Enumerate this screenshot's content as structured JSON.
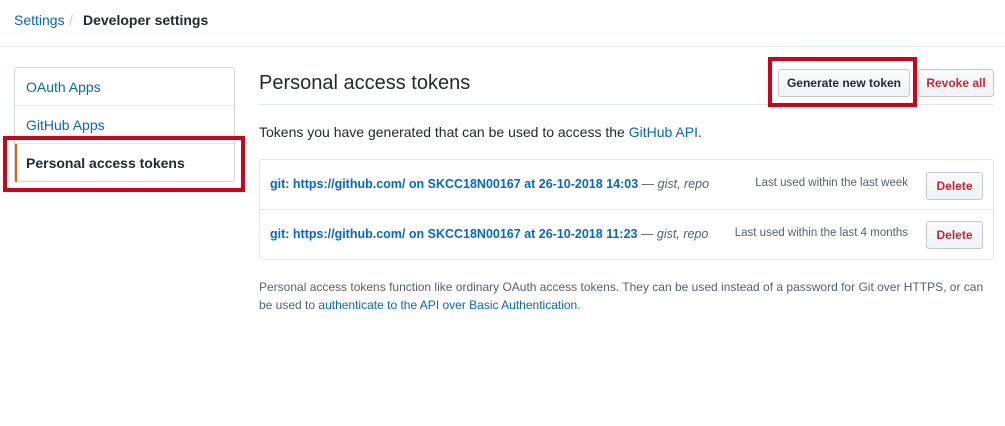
{
  "breadcrumb": {
    "parent": "Settings",
    "separator": "/",
    "current": "Developer settings"
  },
  "sidebar": {
    "items": [
      {
        "label": "OAuth Apps"
      },
      {
        "label": "GitHub Apps"
      },
      {
        "label": "Personal access tokens",
        "selected": true
      }
    ]
  },
  "main": {
    "title": "Personal access tokens",
    "generate_button": "Generate new token",
    "revoke_button": "Revoke all",
    "intro_text": "Tokens you have generated that can be used to access the ",
    "intro_link": "GitHub API",
    "intro_end": ".",
    "tokens": [
      {
        "name": "git: https://github.com/ on SKCC18N00167 at 26-10-2018 14:03",
        "dash": " — ",
        "scopes": "gist, repo",
        "last_used": "Last used within the last week",
        "delete_label": "Delete"
      },
      {
        "name": "git: https://github.com/ on SKCC18N00167 at 26-10-2018 11:23",
        "dash": " — ",
        "scopes": "gist, repo",
        "last_used": "Last used within the last 4 months",
        "delete_label": "Delete"
      }
    ],
    "footnote_text": "Personal access tokens function like ordinary OAuth access tokens. They can be used instead of a password for Git over HTTPS, or can be used to ",
    "footnote_link": "authenticate to the API over Basic Authentication",
    "footnote_end": "."
  },
  "colors": {
    "link": "#0366d6",
    "danger": "#cb2431",
    "highlight_box": "#d0021b",
    "selected_accent": "#e36209"
  }
}
